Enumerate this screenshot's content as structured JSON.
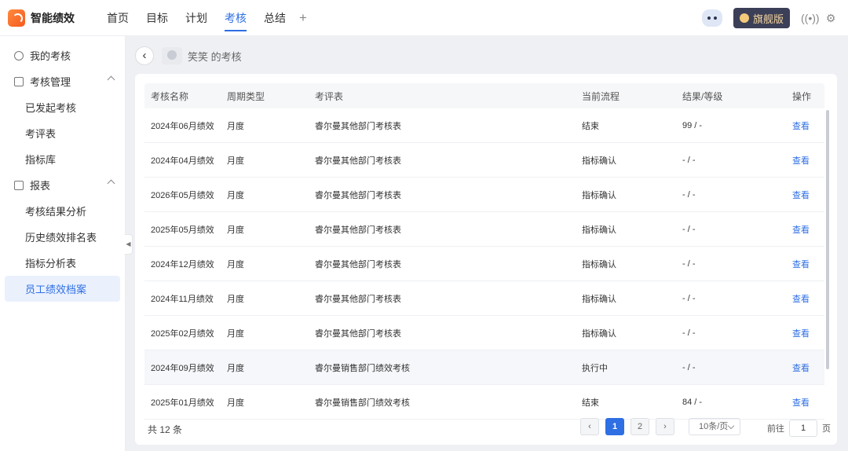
{
  "app": {
    "brand": "智能绩效",
    "logo_text": "绩效"
  },
  "nav": {
    "tabs": [
      {
        "label": "首页"
      },
      {
        "label": "目标"
      },
      {
        "label": "计划"
      },
      {
        "label": "考核"
      },
      {
        "label": "总结"
      }
    ],
    "active": "考核",
    "add_symbol": "+"
  },
  "header_right": {
    "edition_label": "旗舰版",
    "radio_icon": "broadcast-icon",
    "gear_icon": "gear-icon"
  },
  "sidebar": {
    "items": [
      {
        "label": "我的考核",
        "type": "group"
      },
      {
        "label": "考核管理",
        "type": "group",
        "expanded": true
      },
      {
        "label": "已发起考核",
        "type": "sub"
      },
      {
        "label": "考评表",
        "type": "sub"
      },
      {
        "label": "指标库",
        "type": "sub"
      },
      {
        "label": "报表",
        "type": "group",
        "expanded": true
      },
      {
        "label": "考核结果分析",
        "type": "sub"
      },
      {
        "label": "历史绩效排名表",
        "type": "sub"
      },
      {
        "label": "指标分析表",
        "type": "sub"
      },
      {
        "label": "员工绩效档案",
        "type": "sub",
        "active": true
      }
    ]
  },
  "breadcrumb": {
    "text": "笑笑 的考核"
  },
  "table": {
    "headers": [
      "考核名称",
      "周期类型",
      "考评表",
      "当前流程",
      "结果/等级",
      "操作"
    ],
    "rows": [
      [
        "2024年06月绩效",
        "月度",
        "睿尔曼其他部门考核表",
        "结束",
        "99 / -",
        "查看"
      ],
      [
        "2024年04月绩效",
        "月度",
        "睿尔曼其他部门考核表",
        "指标确认",
        "- / -",
        "查看"
      ],
      [
        "2026年05月绩效",
        "月度",
        "睿尔曼其他部门考核表",
        "指标确认",
        "- / -",
        "查看"
      ],
      [
        "2025年05月绩效",
        "月度",
        "睿尔曼其他部门考核表",
        "指标确认",
        "- / -",
        "查看"
      ],
      [
        "2024年12月绩效",
        "月度",
        "睿尔曼其他部门考核表",
        "指标确认",
        "- / -",
        "查看"
      ],
      [
        "2024年11月绩效",
        "月度",
        "睿尔曼其他部门考核表",
        "指标确认",
        "- / -",
        "查看"
      ],
      [
        "2025年02月绩效",
        "月度",
        "睿尔曼其他部门考核表",
        "指标确认",
        "- / -",
        "查看"
      ],
      [
        "2024年09月绩效",
        "月度",
        "睿尔曼销售部门绩效考核",
        "执行中",
        "- / -",
        "查看"
      ],
      [
        "2025年01月绩效",
        "月度",
        "睿尔曼销售部门绩效考核",
        "结束",
        "84 / -",
        "查看"
      ]
    ],
    "highlighted_row": 7
  },
  "pagination": {
    "total_text": "共 12 条",
    "pages": [
      "1",
      "2"
    ],
    "current_page": "1",
    "page_size": "10条/页",
    "goto_label": "前往",
    "goto_value": "1",
    "goto_suffix": "页"
  },
  "colors": {
    "accent": "#2f6fe4",
    "logo": "#f45a1f",
    "edition_bg": "#3b3f57"
  }
}
